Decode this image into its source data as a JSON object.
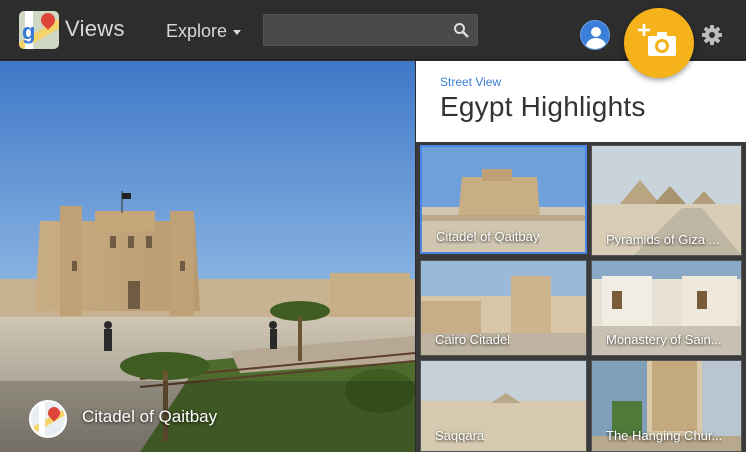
{
  "app": {
    "name": "Views"
  },
  "nav": {
    "explore_label": "Explore"
  },
  "search": {
    "placeholder": "",
    "value": ""
  },
  "icons": {
    "search": "search-icon",
    "account": "account-avatar-icon",
    "add_photo": "add-photo-camera-icon",
    "settings": "gear-icon",
    "maps_logo": "google-maps-logo-icon"
  },
  "colors": {
    "accent": "#f6b21b",
    "link": "#3a7fd9",
    "selection": "#4a86e8",
    "topbar": "#2d2d2d"
  },
  "scene": {
    "title": "Citadel of Qaitbay"
  },
  "panel": {
    "breadcrumb": "Street View",
    "title": "Egypt Highlights",
    "tiles": [
      {
        "label": "Citadel of Qaitbay",
        "selected": true
      },
      {
        "label": "Pyramids of Giza ...",
        "selected": false
      },
      {
        "label": "Cairo Citadel",
        "selected": false
      },
      {
        "label": "Monastery of Sain...",
        "selected": false
      },
      {
        "label": "Saqqara",
        "selected": false
      },
      {
        "label": "The Hanging Chur...",
        "selected": false
      }
    ]
  }
}
